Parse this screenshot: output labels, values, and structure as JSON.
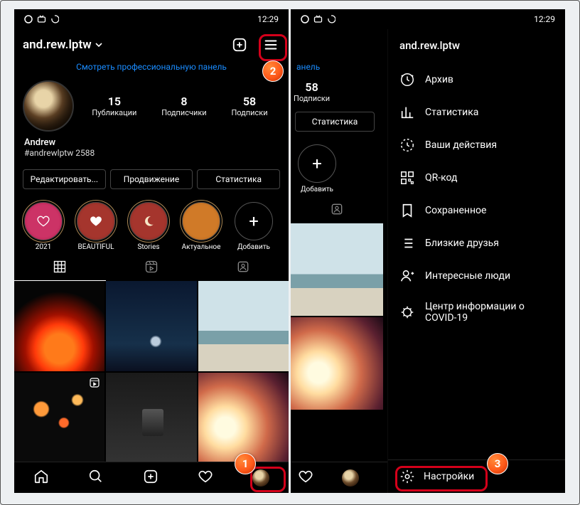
{
  "status": {
    "time": "12:29"
  },
  "profile": {
    "username": "and.rew.lptw",
    "pro_panel": "Смотреть профессиональную панель",
    "stats": {
      "posts_num": "15",
      "posts_lbl": "Публикации",
      "followers_num": "8",
      "followers_lbl": "Подписчики",
      "following_num": "58",
      "following_lbl": "Подписки"
    },
    "name": "Andrew",
    "bio": "#andrewlptw 2588",
    "buttons": {
      "edit": "Редактировать...",
      "promote": "Продвижение",
      "insights": "Статистика"
    },
    "highlights": [
      {
        "label": "2021"
      },
      {
        "label": "BEAUTIFUL"
      },
      {
        "label": "Stories"
      },
      {
        "label": "Актуальное"
      }
    ],
    "add_highlight": "Добавить"
  },
  "drawer": {
    "title": "and.rew.lptw",
    "items": [
      "Архив",
      "Статистика",
      "Ваши действия",
      "QR-код",
      "Сохраненное",
      "Близкие друзья",
      "Интересные люди",
      "Центр информации о COVID-19"
    ],
    "settings": "Настройки"
  },
  "panelB": {
    "pro_panel_fragment": "анель"
  },
  "markers": {
    "m1": "1",
    "m2": "2",
    "m3": "3"
  }
}
